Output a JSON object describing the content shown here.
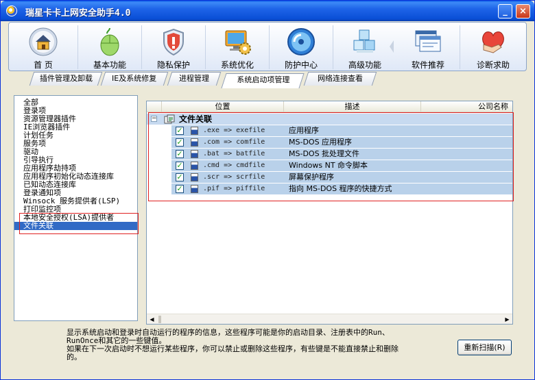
{
  "window": {
    "title": "瑞星卡卡上网安全助手4.0",
    "min_symbol": "_",
    "close_symbol": "×"
  },
  "toolbar": [
    {
      "label": "首  页",
      "icon": "home-icon"
    },
    {
      "label": "基本功能",
      "icon": "mouse-icon"
    },
    {
      "label": "隐私保护",
      "icon": "shield-icon"
    },
    {
      "label": "系统优化",
      "icon": "monitor-gear-icon"
    },
    {
      "label": "防护中心",
      "icon": "globe-icon"
    },
    {
      "label": "高级功能",
      "icon": "cubes-icon"
    },
    {
      "label": "软件推荐",
      "icon": "windows-icon"
    },
    {
      "label": "诊断求助",
      "icon": "heart-hand-icon"
    }
  ],
  "subtabs": [
    {
      "label": "插件管理及卸载"
    },
    {
      "label": "IE及系统修复"
    },
    {
      "label": "进程管理"
    },
    {
      "label": "系统启动项管理",
      "active": true
    },
    {
      "label": "网络连接查看"
    }
  ],
  "leftlist": [
    "全部",
    "登录项",
    "资源管理器插件",
    "IE浏览器插件",
    "计划任务",
    "服务项",
    "驱动",
    "引导执行",
    "应用程序劫持项",
    "应用程序初始化动态连接库",
    "已知动态连接库",
    "登录通知项",
    "Winsock 服务提供者(LSP)",
    "打印监控项",
    "本地安全授权(LSA)提供者",
    "文件关联"
  ],
  "leftlist_selected": "文件关联",
  "columns": {
    "location": "位置",
    "description": "描述",
    "company": "公司名称"
  },
  "tree": {
    "root_label": "文件关联",
    "expander": "−",
    "rows": [
      {
        "ext": ".exe => exefile",
        "desc": "应用程序",
        "checked": true
      },
      {
        "ext": ".com => comfile",
        "desc": "MS-DOS 应用程序",
        "checked": true
      },
      {
        "ext": ".bat => batfile",
        "desc": "MS-DOS 批处理文件",
        "checked": true
      },
      {
        "ext": ".cmd => cmdfile",
        "desc": "Windows NT 命令脚本",
        "checked": true
      },
      {
        "ext": ".scr => scrfile",
        "desc": "屏幕保护程序",
        "checked": true
      },
      {
        "ext": ".pif => piffile",
        "desc": "指向 MS-DOS 程序的快捷方式",
        "checked": true
      }
    ]
  },
  "info": {
    "line1": "显示系统启动和登录时自动运行的程序的信息，这些程序可能是你的启动目录、注册表中的Run、",
    "line2": "RunOnce和其它的一些键值。",
    "line3": "如果在下一次启动时不想运行某些程序，你可以禁止或删除这些程序，有些键是不能直接禁止和删除",
    "line4": "的。"
  },
  "rescan_label": "重新扫描(R)",
  "scroll": {
    "left_arrow": "◀",
    "right_arrow": "▶"
  }
}
